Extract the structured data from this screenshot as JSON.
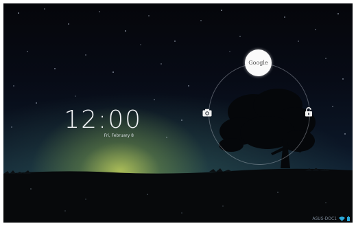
{
  "lockscreen": {
    "time": "12:00",
    "date": "Fri, February 8",
    "google_label": "Google",
    "camera_icon": "camera-icon",
    "unlock_icon": "unlock-icon"
  },
  "status_bar": {
    "device_name": "ASUS-DOC1",
    "wifi_icon": "wifi-icon",
    "battery_icon": "battery-icon"
  },
  "colors": {
    "wifi": "#2aa8d8",
    "battery": "#2aa8d8"
  }
}
